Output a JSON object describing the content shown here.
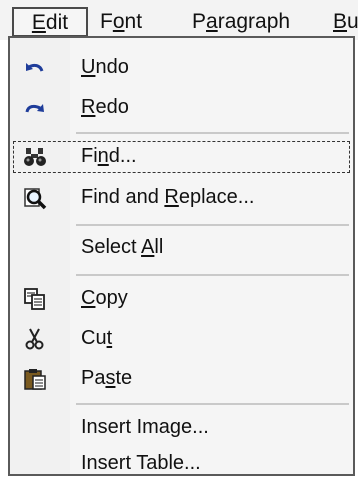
{
  "menubar": {
    "edit": "Edit",
    "font": "Font",
    "paragraph": "Paragraph",
    "bu": "Bu"
  },
  "menu": {
    "undo": "Undo",
    "redo": "Redo",
    "find": "Find...",
    "find_replace": "Find and Replace...",
    "select_all": "Select All",
    "copy": "Copy",
    "cut": "Cut",
    "paste": "Paste",
    "insert_image": "Insert Image...",
    "insert_table": "Insert Table..."
  },
  "icons": {
    "undo": "undo-arrow-icon",
    "redo": "redo-arrow-icon",
    "find": "binoculars-icon",
    "find_replace": "magnifier-page-icon",
    "copy": "copy-icon",
    "cut": "scissors-icon",
    "paste": "clipboard-icon"
  },
  "colors": {
    "menu_bg": "#f5f5f5",
    "border": "#5a5a5a",
    "icon_blue": "#1f3d9a"
  }
}
